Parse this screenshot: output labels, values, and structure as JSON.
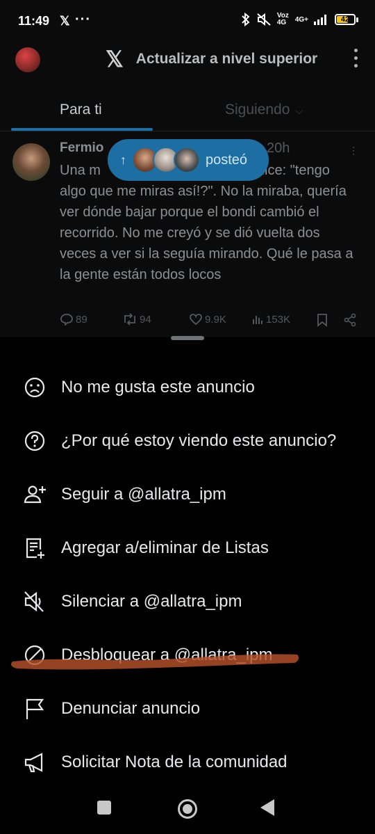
{
  "status_bar": {
    "time": "11:49",
    "app_icon": "x-logo",
    "more": "···",
    "network_label": "Voz 4G",
    "network_label2": "4G+",
    "battery": "42"
  },
  "header": {
    "title": "Actualizar a nivel superior"
  },
  "tabs": [
    {
      "label": "Para ti",
      "active": true
    },
    {
      "label": "Siguiendo",
      "active": false
    }
  ],
  "tweet": {
    "name": "Fermio",
    "time": "20h",
    "text": "Una m… dice: \"tengo algo que me miras así!?\". No la miraba, quería ver dónde bajar porque el bondi cambió el recorrido. No me creyó y se dió vuelta dos veces a ver si la seguía mirando. Qué le pasa a la gente están todos locos",
    "text_line1_left": "Una m",
    "text_line1_right": "dice: \"tengo",
    "text_rest": "algo que me miras así!?\". No la miraba, quería ver dónde bajar porque el bondi cambió el recorrido. No me creyó y se dió vuelta dos veces a ver si la seguía mirando. Qué le pasa a la gente están todos locos",
    "replies": "89",
    "retweets": "94",
    "likes": "9.9K",
    "views": "153K"
  },
  "new_posts_pill": {
    "label": "posteó"
  },
  "menu": {
    "items": [
      {
        "label": "No me gusta este anuncio",
        "icon": "frown-icon"
      },
      {
        "label": "¿Por qué estoy viendo este anuncio?",
        "icon": "question-circle-icon"
      },
      {
        "label": "Seguir a @allatra_ipm",
        "icon": "user-plus-icon"
      },
      {
        "label": "Agregar a/eliminar de Listas",
        "icon": "list-add-icon"
      },
      {
        "label": "Silenciar a @allatra_ipm",
        "icon": "mute-icon"
      },
      {
        "label": "Desbloquear a @allatra_ipm",
        "icon": "unblock-icon"
      },
      {
        "label": "Denunciar anuncio",
        "icon": "flag-icon"
      },
      {
        "label": "Solicitar Nota de la comunidad",
        "icon": "megaphone-icon"
      }
    ]
  },
  "colors": {
    "accent": "#1d6fa3",
    "scribble": "#b4502a"
  }
}
